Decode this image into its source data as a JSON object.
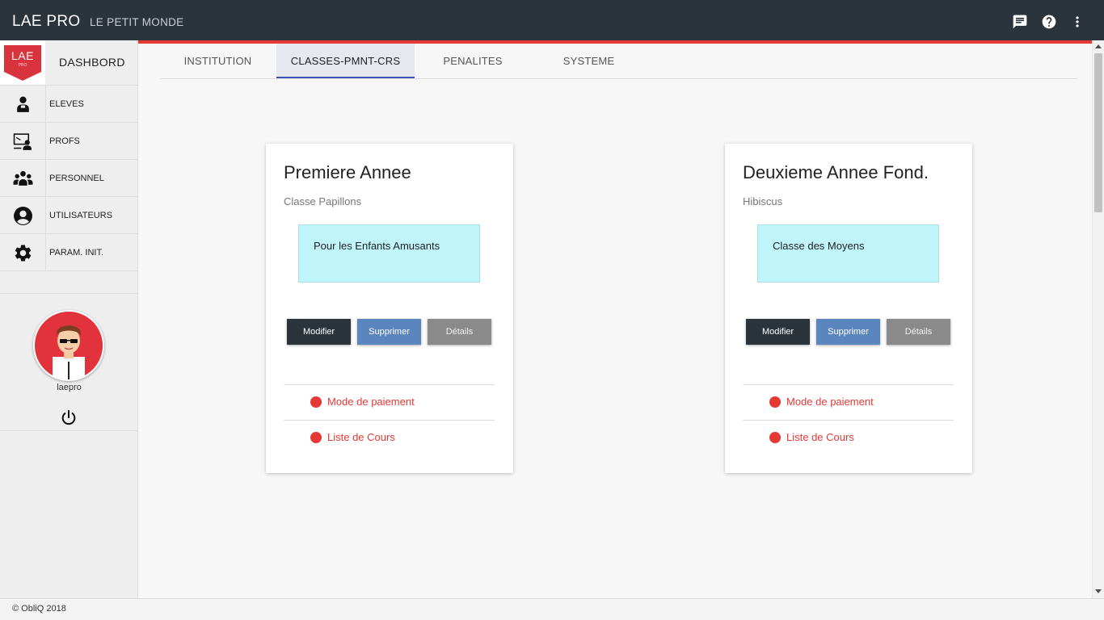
{
  "app": {
    "title": "LAE PRO",
    "org": "LE PETIT MONDE"
  },
  "topbar_icons": [
    "chat-icon",
    "help-icon",
    "more-vert-icon"
  ],
  "sidebar": {
    "logo_text": "LAE",
    "logo_sub": "PRO",
    "brand_label": "DASHBORD",
    "items": [
      {
        "label": "ELEVES",
        "icon": "student-icon"
      },
      {
        "label": "PROFS",
        "icon": "teacher-icon"
      },
      {
        "label": "PERSONNEL",
        "icon": "group-icon"
      },
      {
        "label": "UTILISATEURS",
        "icon": "user-icon"
      },
      {
        "label": "PARAM. INIT.",
        "icon": "gear-icon"
      }
    ],
    "username": "laepro"
  },
  "tabs": [
    {
      "label": "INSTITUTION",
      "active": false
    },
    {
      "label": "CLASSES-PMNT-CRS",
      "active": true
    },
    {
      "label": "PENALITES",
      "active": false
    },
    {
      "label": "SYSTEME",
      "active": false
    }
  ],
  "cards": [
    {
      "title": "Premiere Annee",
      "subtitle": "Classe Papillons",
      "description": "Pour les Enfants Amusants",
      "buttons": {
        "modifier": "Modifier",
        "supprimer": "Supprimer",
        "details": "Détails"
      },
      "links": [
        "Mode de paiement",
        "Liste de Cours"
      ]
    },
    {
      "title": "Deuxieme Annee Fond.",
      "subtitle": "Hibiscus",
      "description": "Classe des Moyens",
      "buttons": {
        "modifier": "Modifier",
        "supprimer": "Supprimer",
        "details": "Détails"
      },
      "links": [
        "Mode de paiement",
        "Liste de Cours"
      ]
    }
  ],
  "footer": {
    "copyright": "© ObliQ 2018"
  },
  "colors": {
    "topbar": "#2b333b",
    "accent_red": "#e53935",
    "tab_indicator": "#3f51b5",
    "card_desc_bg": "#bff5fb",
    "btn_supprimer": "#5b86bd",
    "btn_details": "#8a8a8a"
  }
}
